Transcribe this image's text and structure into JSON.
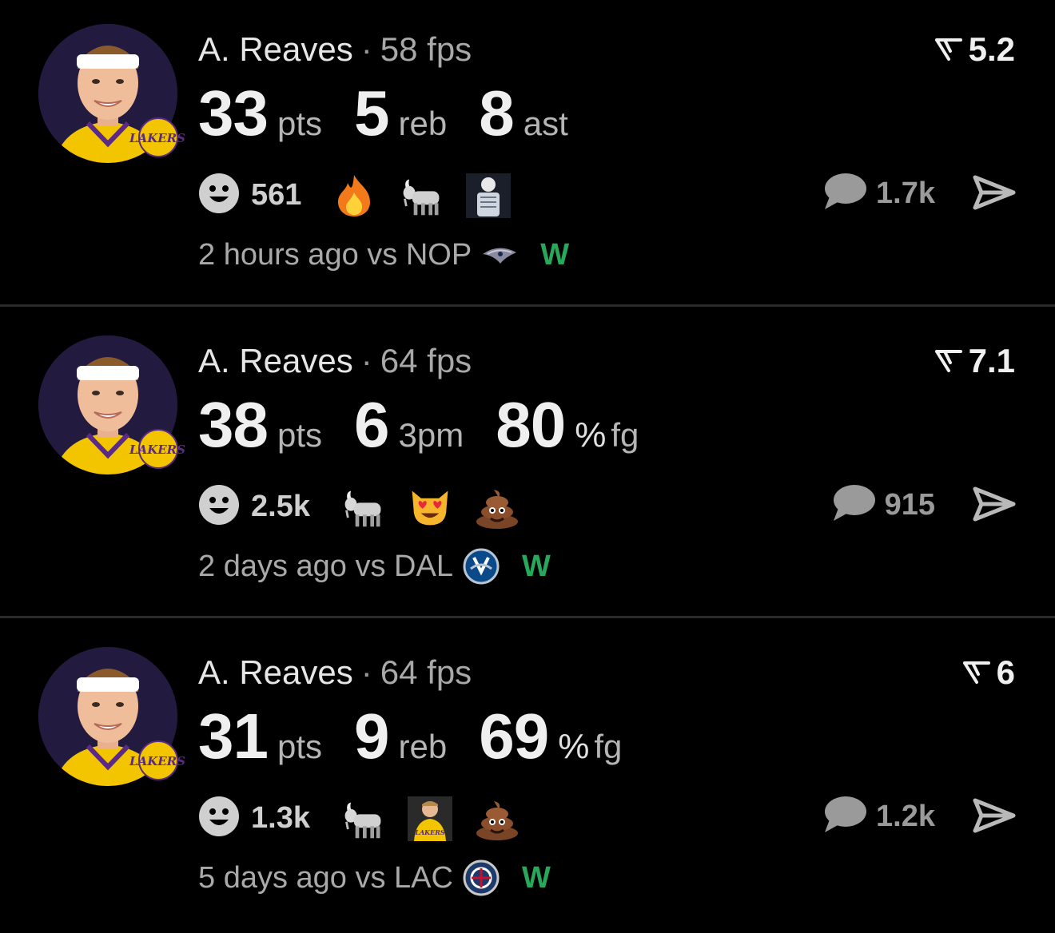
{
  "posts": [
    {
      "player": "A. Reaves",
      "separator": "·",
      "fps": "58 fps",
      "rating": "5.2",
      "stats": [
        {
          "value": "33",
          "prefix": "",
          "unit": "pts"
        },
        {
          "value": "5",
          "prefix": "",
          "unit": "reb"
        },
        {
          "value": "8",
          "prefix": "",
          "unit": "ast"
        }
      ],
      "reaction_count": "561",
      "emojis": [
        "fire-emoji",
        "goat-emoji",
        "xray-player-sticker"
      ],
      "comment_count": "1.7k",
      "time": "2 hours ago",
      "vs": "vs NOP",
      "opponent_logo": "pelicans-logo",
      "result": "W"
    },
    {
      "player": "A. Reaves",
      "separator": "·",
      "fps": "64 fps",
      "rating": "7.1",
      "stats": [
        {
          "value": "38",
          "prefix": "",
          "unit": "pts"
        },
        {
          "value": "6",
          "prefix": "",
          "unit": "3pm"
        },
        {
          "value": "80",
          "prefix": "%",
          "unit": "fg"
        }
      ],
      "reaction_count": "2.5k",
      "emojis": [
        "goat-emoji",
        "heart-eyes-cat-emoji",
        "poop-emoji"
      ],
      "comment_count": "915",
      "time": "2 days ago",
      "vs": "vs DAL",
      "opponent_logo": "mavericks-logo",
      "result": "W"
    },
    {
      "player": "A. Reaves",
      "separator": "·",
      "fps": "64 fps",
      "rating": "6",
      "stats": [
        {
          "value": "31",
          "prefix": "",
          "unit": "pts"
        },
        {
          "value": "9",
          "prefix": "",
          "unit": "reb"
        },
        {
          "value": "69",
          "prefix": "%",
          "unit": "fg"
        }
      ],
      "reaction_count": "1.3k",
      "emojis": [
        "goat-emoji",
        "lakers-player-sticker",
        "poop-emoji"
      ],
      "comment_count": "1.2k",
      "time": "5 days ago",
      "vs": "vs LAC",
      "opponent_logo": "clippers-logo",
      "result": "W"
    }
  ],
  "colors": {
    "background": "#000000",
    "win": "#27a85a",
    "divider": "#2a2a2a",
    "avatar_bg": "#231a40"
  }
}
